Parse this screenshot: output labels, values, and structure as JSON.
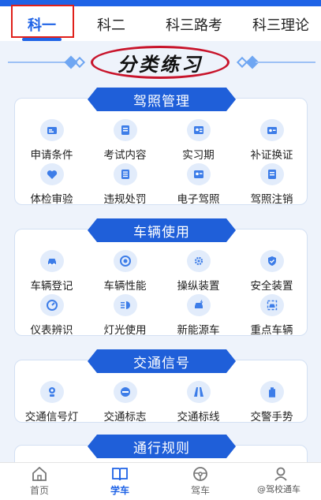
{
  "tabs": [
    "科一",
    "科二",
    "科三路考",
    "科三理论"
  ],
  "active_tab": "科一",
  "page_title": "分类练习",
  "sections": [
    {
      "title": "驾照管理",
      "items": [
        {
          "label": "申请条件",
          "icon": "id-card-icon"
        },
        {
          "label": "考试内容",
          "icon": "document-icon"
        },
        {
          "label": "实习期",
          "icon": "intern-card-icon"
        },
        {
          "label": "补证换证",
          "icon": "license-replace-icon"
        },
        {
          "label": "体检审验",
          "icon": "heart-check-icon"
        },
        {
          "label": "违规处罚",
          "icon": "penalty-list-icon"
        },
        {
          "label": "电子驾照",
          "icon": "e-license-icon"
        },
        {
          "label": "驾照注销",
          "icon": "license-cancel-icon"
        }
      ]
    },
    {
      "title": "车辆使用",
      "items": [
        {
          "label": "车辆登记",
          "icon": "car-register-icon"
        },
        {
          "label": "车辆性能",
          "icon": "speedometer-icon"
        },
        {
          "label": "操纵装置",
          "icon": "gear-icon"
        },
        {
          "label": "安全装置",
          "icon": "shield-icon"
        },
        {
          "label": "仪表辨识",
          "icon": "gauge-icon"
        },
        {
          "label": "灯光使用",
          "icon": "headlight-icon"
        },
        {
          "label": "新能源车",
          "icon": "new-energy-car-icon"
        },
        {
          "label": "重点车辆",
          "icon": "key-vehicle-icon"
        }
      ]
    },
    {
      "title": "交通信号",
      "items": [
        {
          "label": "交通信号灯",
          "icon": "traffic-light-icon"
        },
        {
          "label": "交通标志",
          "icon": "no-entry-sign-icon"
        },
        {
          "label": "交通标线",
          "icon": "road-lines-icon"
        },
        {
          "label": "交警手势",
          "icon": "hand-gesture-icon"
        }
      ]
    },
    {
      "title": "通行规则",
      "items": []
    }
  ],
  "bottom_nav": [
    {
      "label": "首页",
      "icon": "home-icon"
    },
    {
      "label": "学车",
      "icon": "book-icon"
    },
    {
      "label": "驾车",
      "icon": "steering-wheel-icon"
    },
    {
      "label": "",
      "icon": "profile-icon"
    }
  ],
  "active_nav": "学车",
  "watermark": "@驾校通车",
  "colors": {
    "primary": "#1f63e6",
    "ribbon": "#1f5fd9",
    "highlight_border": "#e0201a",
    "icon_bg": "#e2ecfb",
    "page_bg": "#eef3fb"
  }
}
